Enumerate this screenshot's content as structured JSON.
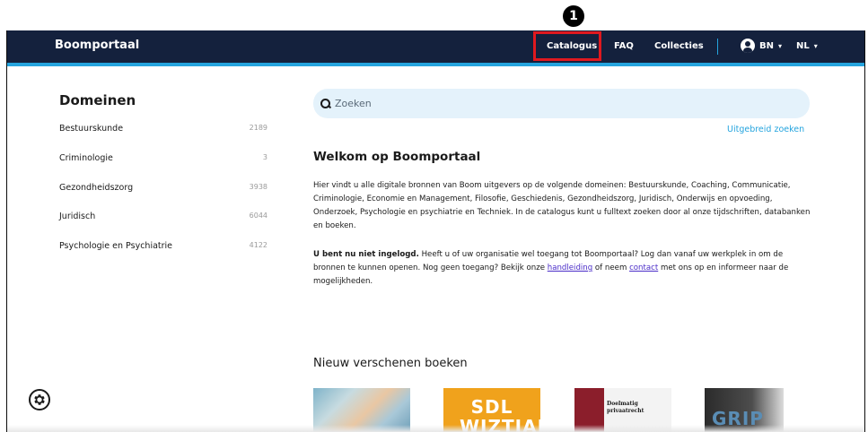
{
  "annotation": {
    "step_number": "1"
  },
  "navbar": {
    "brand": "Boomportaal",
    "items": [
      "Catalogus",
      "FAQ",
      "Collecties"
    ],
    "user": "BN",
    "language": "NL"
  },
  "sidebar": {
    "title": "Domeinen",
    "domains": [
      {
        "label": "Bestuurskunde",
        "count": "2189"
      },
      {
        "label": "Criminologie",
        "count": "3"
      },
      {
        "label": "Gezondheidszorg",
        "count": "3938"
      },
      {
        "label": "Juridisch",
        "count": "6044"
      },
      {
        "label": "Psychologie en Psychiatrie",
        "count": "4122"
      }
    ]
  },
  "search": {
    "placeholder": "Zoeken",
    "advanced_label": "Uitgebreid zoeken"
  },
  "welcome": {
    "title": "Welkom op Boomportaal",
    "intro": "Hier vindt u alle digitale bronnen van Boom uitgevers op de volgende domeinen: Bestuurskunde, Coaching, Communicatie, Criminologie, Economie en Management, Filosofie, Geschiedenis, Gezondheidszorg, Juridisch, Onderwijs en opvoeding, Onderzoek, Psychologie en psychiatrie en Techniek. In de catalogus kunt u fulltext zoeken door al onze tijdschriften, databanken en boeken.",
    "login_bold": "U bent nu niet ingelogd.",
    "login_text_1": " Heeft u of uw organisatie wel toegang tot Boomportaal? Log dan vanaf uw werkplek in om de bronnen te kunnen openen. Nog geen toegang? Bekijk onze ",
    "login_link_1": "handleiding",
    "login_text_2": " of neem ",
    "login_link_2": "contact",
    "login_text_3": " met ons op en informeer naar de mogelijkheden."
  },
  "new_books": {
    "title": "Nieuw verschenen boeken",
    "books": [
      {
        "cover_text": ""
      },
      {
        "cover_text": "SDL WIZTIAE"
      },
      {
        "cover_text": "Doelmatig privaatrecht"
      },
      {
        "cover_text": "GRIP"
      }
    ]
  },
  "icons": {
    "settings": "gear-icon",
    "search": "search-icon",
    "user": "user-circle-icon"
  },
  "colors": {
    "navbar": "#14213d",
    "accent": "#25a4de",
    "highlight": "#e0191f"
  }
}
